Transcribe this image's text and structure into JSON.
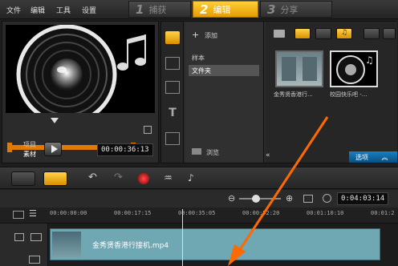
{
  "menubar": {
    "items": [
      "文件",
      "编辑",
      "工具",
      "设置"
    ],
    "steps": [
      {
        "num": "1",
        "label": "捕获"
      },
      {
        "num": "2",
        "label": "编辑"
      },
      {
        "num": "3",
        "label": "分享"
      }
    ]
  },
  "preview": {
    "mode_project": "项目",
    "mode_clip": "素材",
    "timecode": "00:00:36:13"
  },
  "library": {
    "add_label": "添加",
    "folders": [
      "样本",
      "文件夹"
    ],
    "browse_label": "浏览",
    "thumbs": [
      {
        "caption": "金秀贤香港行..."
      },
      {
        "caption": "校园快乐吧 -..."
      }
    ],
    "options_label": "选项"
  },
  "timeline": {
    "timecode": "0:04:03:14",
    "ruler": [
      "00:00:00:00",
      "00:00:17:15",
      "00:00:35:05",
      "00:00:52:20",
      "00:01:10:10",
      "00:01:2"
    ],
    "clip_label": "金秀贤香港行接机.mp4"
  },
  "colors": {
    "accent": "#f0a800",
    "playhead": "#e07a00",
    "clip": "#6fa7b3",
    "options": "#1780c4"
  }
}
